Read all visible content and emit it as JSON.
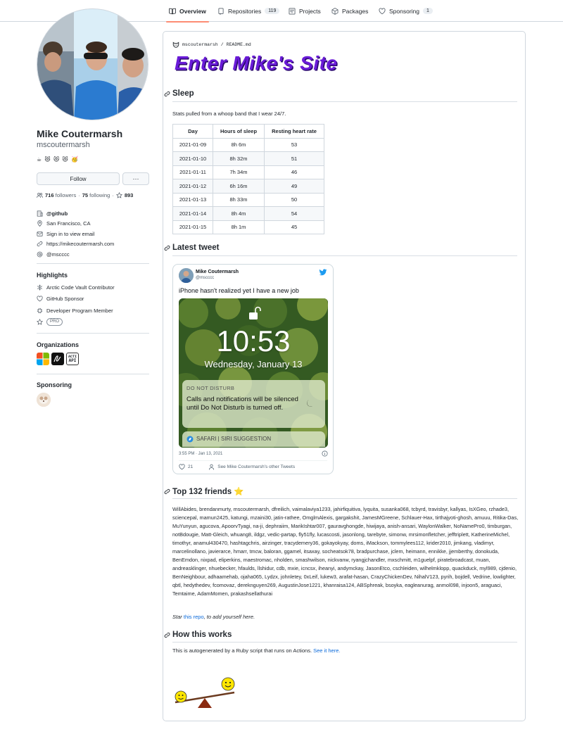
{
  "nav": {
    "tabs": [
      {
        "label": "Overview",
        "icon": "book-icon",
        "active": true
      },
      {
        "label": "Repositories",
        "icon": "repo-icon",
        "count": "119"
      },
      {
        "label": "Projects",
        "icon": "project-icon"
      },
      {
        "label": "Packages",
        "icon": "package-icon"
      },
      {
        "label": "Sponsoring",
        "icon": "heart-icon",
        "count": "1"
      }
    ]
  },
  "profile": {
    "full_name": "Mike Coutermarsh",
    "login": "mscoutermarsh",
    "status_emojis": "☕ 😻 😻 😻 🥳",
    "follow_label": "Follow",
    "more_label": "···",
    "followers_count": "716",
    "followers_label": "followers",
    "following_count": "75",
    "following_label": "following",
    "stars_count": "893",
    "company": "@github",
    "location": "San Francisco, CA",
    "email": "Sign in to view email",
    "website": "https://mikecoutermarsh.com",
    "twitter": "@mscccc"
  },
  "highlights": {
    "title": "Highlights",
    "items": [
      "Arctic Code Vault Contributor",
      "GitHub Sponsor",
      "Developer Program Member"
    ],
    "pro_badge": "PRO"
  },
  "organizations": {
    "title": "Organizations",
    "api_label_1": "ACTI",
    "api_label_2": "API"
  },
  "sponsoring": {
    "title": "Sponsoring"
  },
  "readme": {
    "path_user": "mscoutermarsh",
    "path_sep": "/",
    "path_file": "README.md",
    "banner": "Enter Mike's Site",
    "sleep_heading": "Sleep",
    "sleep_desc": "Stats pulled from a whoop band that I wear 24/7.",
    "sleep_table": {
      "headers": [
        "Day",
        "Hours of sleep",
        "Resting heart rate"
      ],
      "rows": [
        [
          "2021-01-09",
          "8h 6m",
          "53"
        ],
        [
          "2021-01-10",
          "8h 32m",
          "51"
        ],
        [
          "2021-01-11",
          "7h 34m",
          "46"
        ],
        [
          "2021-01-12",
          "6h 16m",
          "49"
        ],
        [
          "2021-01-13",
          "8h 33m",
          "50"
        ],
        [
          "2021-01-14",
          "8h 4m",
          "54"
        ],
        [
          "2021-01-15",
          "8h 1m",
          "45"
        ]
      ]
    },
    "tweet_heading": "Latest tweet",
    "tweet": {
      "name": "Mike Coutermarsh",
      "handle": "@mscccc",
      "text": "iPhone hasn't realized yet I have a new job",
      "lock_time": "10:53",
      "lock_date": "Wednesday, January 13",
      "dnd_title": "DO NOT DISTURB",
      "dnd_text": "Calls and notifications will be silenced until Do Not Disturb is turned off.",
      "siri_text": "SAFARI | SIRI SUGGESTION",
      "timestamp": "3:55 PM · Jan 13, 2021",
      "likes": "21",
      "see_more": "See Mike Coutermarsh's other Tweets"
    },
    "friends_heading": "Top 132 friends ⭐",
    "friends_text": "WillAbides, brendanmurty, mscoutermarsh, dfreilich, vaimalaviya1233, jahirfiquitiva, lyquita, susanka068, tcbyrd, travisbyr, kallyas, IsXGeo, rzhade3, sciencepal, mamun2425, katungi, mzaini30, jatin-rathee, OmglmAlexis, gargakshit, JamesMGreene, Schlauer-Hax, tirthajyoti-ghosh, amuuu, Ritika-Das, MuYunyun, agucova, ApoorvTyagi, na-ji, dephraiim, MarikIshtar007, gauravghongde, hiwijaya, anish-ansari, WaylonWalker, NoNamePro0, timburgan, notBdougie, Matt-Gleich, whuang8, ildgz, vedic-partap, fly51fly, lucascosti, jasonlong, tarebyte, simonw, mrsimonfletcher, jefftriplett, KatherineMichel, timothyr, anamul430470, hashtagchris, airzinger, tracydemery36, gokayokyay, doms, iMackson, tommylees112, krider2010, jimkang, vladimyr, marcelinollano, javierarce, hmarr, tmcw, baloran, ggamel, itsaxay, socheatsok78, bradpurchase, jclem, heimann, ennikke, jjemberthy, donokuda, BenEmdon, nixpad, eliperkins, maestromac, nholden, smashwilson, nickvanw, ryangjchandler, mxschmitt, m1guelpf, piratebroadcast, muan, andreasklinger, nhuebecker, hfaulds, llshidur, cdb, mxie, icncsx, iheanyi, andymckay, JasonEtco, cschleiden, wilhelmklopp, quackduck, myl989, cjdenio, BenNeighbour, adhaamehab, ojaha065, Lydzx, johnletey, 0xLeif, lukew3, arafat-hasan, CrazyChickenDev, NihalV123, pyrih, bojdell, Vedrine, lowlighter, qbtl, hedythedev, fcomovaz, dereknguyen269, AugustinJose1221, khanraisa124, ABSphreak, bsoyka, eagleanurag, anmol098, injoon5, araguaci, Temtaime, AdamMomen, prakashsellathurai",
    "star_prefix": "Star",
    "star_link": "this repo",
    "star_suffix": ", to add yourself here.",
    "how_heading": "How this works",
    "how_text": "This is autogenerated by a Ruby script that runs on Actions.",
    "how_link": "See it here."
  },
  "colors": {
    "tab_underline": "#fd8c73",
    "link": "#0969da",
    "banner": "#6a1bd8",
    "border": "#d0d7de"
  }
}
